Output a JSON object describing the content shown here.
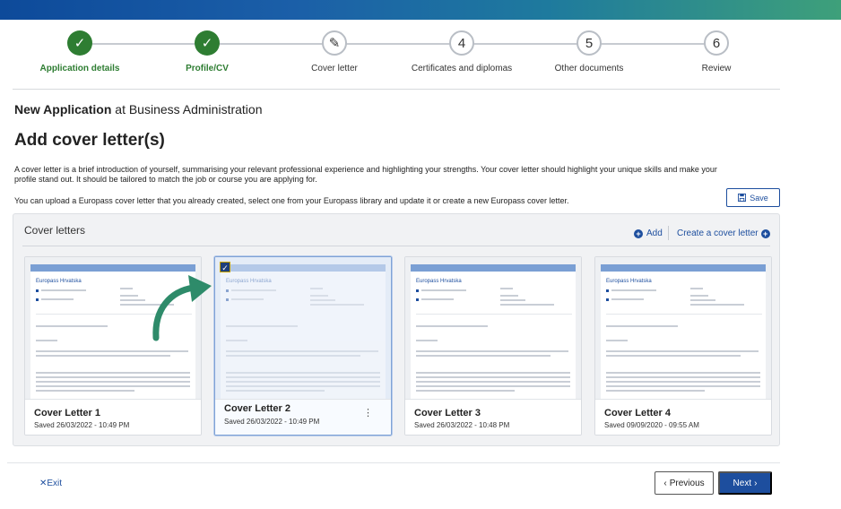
{
  "steps": [
    {
      "label": "Application details",
      "state": "done",
      "marker": "✓"
    },
    {
      "label": "Profile/CV",
      "state": "done",
      "marker": "✓"
    },
    {
      "label": "Cover letter",
      "state": "current",
      "marker": "✎"
    },
    {
      "label": "Certificates and diplomas",
      "state": "todo",
      "marker": "4"
    },
    {
      "label": "Other documents",
      "state": "todo",
      "marker": "5"
    },
    {
      "label": "Review",
      "state": "todo",
      "marker": "6"
    }
  ],
  "context": {
    "prefix": "New Application",
    "suffix": "at Business Administration"
  },
  "page_title": "Add cover letter(s)",
  "description": "A cover letter is a brief introduction of yourself, summarising your relevant professional experience and highlighting your strengths. Your cover letter should highlight your unique skills and make your profile stand out. It should be tailored to match the job or course you are applying for.",
  "upload_info": "You can upload a Europass cover letter that you already created, select one from your Europass library and update it or create a new Europass cover letter.",
  "save_label": "Save",
  "panel": {
    "title": "Cover letters",
    "add_label": "Add",
    "create_label": "Create a cover letter"
  },
  "cards": [
    {
      "name": "Cover Letter 1",
      "saved": "Saved 26/03/2022 - 10:49 PM",
      "doc_name": "Europass Hrvatska",
      "selected": false
    },
    {
      "name": "Cover Letter 2",
      "saved": "Saved 26/03/2022 - 10:49 PM",
      "doc_name": "Europass Hrvatska",
      "selected": true
    },
    {
      "name": "Cover Letter 3",
      "saved": "Saved 26/03/2022 - 10:48 PM",
      "doc_name": "Europass Hrvatska",
      "selected": false
    },
    {
      "name": "Cover Letter 4",
      "saved": "Saved 09/09/2020 - 09:55 AM",
      "doc_name": "Europass Hrvatska",
      "selected": false
    }
  ],
  "footer": {
    "exit_label": "Exit",
    "previous_label": "Previous",
    "next_label": "Next"
  },
  "colors": {
    "primary": "#1d4e9e",
    "success": "#2e7d32",
    "annotation_arrow": "#2e8b6a"
  },
  "icons": {
    "exit": "close-icon",
    "save": "floppy-disk-icon",
    "add": "plus-circle-icon",
    "previous": "chevron-left-icon",
    "next": "chevron-right-icon"
  }
}
